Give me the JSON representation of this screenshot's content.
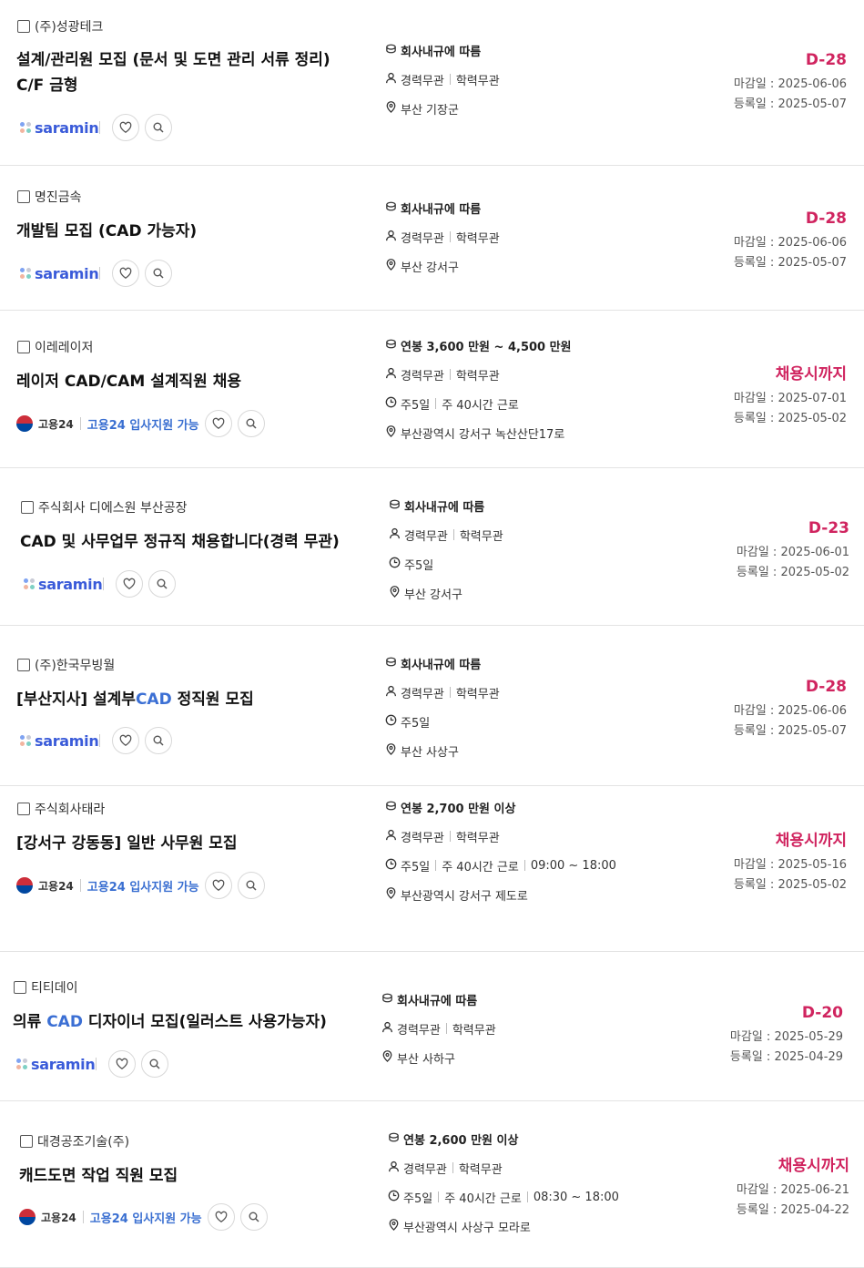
{
  "jobs": [
    {
      "company": "(주)성광테크",
      "title_parts": [
        "설계/관리원 모집 (문서 및 도면 관리 서류 정리) C/F 금형"
      ],
      "source": "saramin",
      "source_label": "saramin",
      "salary": "회사내규에 따름",
      "experience": "경력무관",
      "education": "학력무관",
      "work": [],
      "location": "부산 기장군",
      "dday": "D-28",
      "deadline": "마감일 : 2025-06-06",
      "registered": "등록일 : 2025-05-07"
    },
    {
      "company": "명진금속",
      "title_parts": [
        "개발팀 모집 (CAD 가능자)"
      ],
      "source": "saramin",
      "source_label": "saramin",
      "salary": "회사내규에 따름",
      "experience": "경력무관",
      "education": "학력무관",
      "work": [],
      "location": "부산 강서구",
      "dday": "D-28",
      "deadline": "마감일 : 2025-06-06",
      "registered": "등록일 : 2025-05-07"
    },
    {
      "company": "이레레이저",
      "title_parts": [
        "레이저 CAD/CAM 설계직원 채용"
      ],
      "source": "goyong",
      "source_label": "고용24",
      "source_support": "고용24 입사지원 가능",
      "salary": "연봉 3,600 만원 ~ 4,500 만원",
      "experience": "경력무관",
      "education": "학력무관",
      "work": [
        "주5일",
        "주 40시간 근로"
      ],
      "location": "부산광역시 강서구 녹산산단17로",
      "dday": "채용시까지",
      "deadline": "마감일 : 2025-07-01",
      "registered": "등록일 : 2025-05-02"
    },
    {
      "company": "주식회사 디에스원 부산공장",
      "title_parts": [
        "CAD 및 사무업무 정규직 채용합니다(경력 무관)"
      ],
      "source": "saramin",
      "source_label": "saramin",
      "salary": "회사내규에 따름",
      "experience": "경력무관",
      "education": "학력무관",
      "work": [
        "주5일"
      ],
      "location": "부산 강서구",
      "dday": "D-23",
      "deadline": "마감일 : 2025-06-01",
      "registered": "등록일 : 2025-05-02"
    },
    {
      "company": "(주)한국무빙월",
      "title_parts": [
        "[부산지사] 설계부",
        "CAD",
        " 정직원 모집"
      ],
      "highlight_index": 1,
      "source": "saramin",
      "source_label": "saramin",
      "salary": "회사내규에 따름",
      "experience": "경력무관",
      "education": "학력무관",
      "work": [
        "주5일"
      ],
      "location": "부산 사상구",
      "dday": "D-28",
      "deadline": "마감일 : 2025-06-06",
      "registered": "등록일 : 2025-05-07"
    },
    {
      "company": "주식회사태라",
      "title_parts": [
        "[강서구 강동동] 일반 사무원 모집"
      ],
      "source": "goyong",
      "source_label": "고용24",
      "source_support": "고용24 입사지원 가능",
      "salary": "연봉 2,700 만원 이상",
      "experience": "경력무관",
      "education": "학력무관",
      "work": [
        "주5일",
        "주 40시간 근로",
        "09:00 ~ 18:00"
      ],
      "location": "부산광역시 강서구 제도로",
      "dday": "채용시까지",
      "deadline": "마감일 : 2025-05-16",
      "registered": "등록일 : 2025-05-02"
    },
    {
      "company": "티티데이",
      "title_parts": [
        "의류 ",
        "CAD",
        " 디자이너 모집(일러스트 사용가능자)"
      ],
      "highlight_index": 1,
      "source": "saramin",
      "source_label": "saramin",
      "salary": "회사내규에 따름",
      "experience": "경력무관",
      "education": "학력무관",
      "work": [],
      "location": "부산 사하구",
      "dday": "D-20",
      "deadline": "마감일 : 2025-05-29",
      "registered": "등록일 : 2025-04-29"
    },
    {
      "company": "대경공조기술(주)",
      "title_parts": [
        "캐드도면 작업 직원 모집"
      ],
      "source": "goyong",
      "source_label": "고용24",
      "source_support": "고용24 입사지원 가능",
      "salary": "연봉 2,600 만원 이상",
      "experience": "경력무관",
      "education": "학력무관",
      "work": [
        "주5일",
        "주 40시간 근로",
        "08:30 ~ 18:00"
      ],
      "location": "부산광역시 사상구 모라로",
      "dday": "채용시까지",
      "deadline": "마감일 : 2025-06-21",
      "registered": "등록일 : 2025-04-22"
    }
  ],
  "icons": {
    "salary": "coin-icon",
    "person": "person-icon",
    "clock": "clock-icon",
    "location": "location-pin-icon",
    "heart": "heart-icon",
    "search": "magnifier-icon"
  },
  "colors": {
    "dday": "#d0245f",
    "saramin": "#3a5bd9",
    "highlight": "#3b6fd4",
    "goyong_support": "#3a6fd1"
  }
}
